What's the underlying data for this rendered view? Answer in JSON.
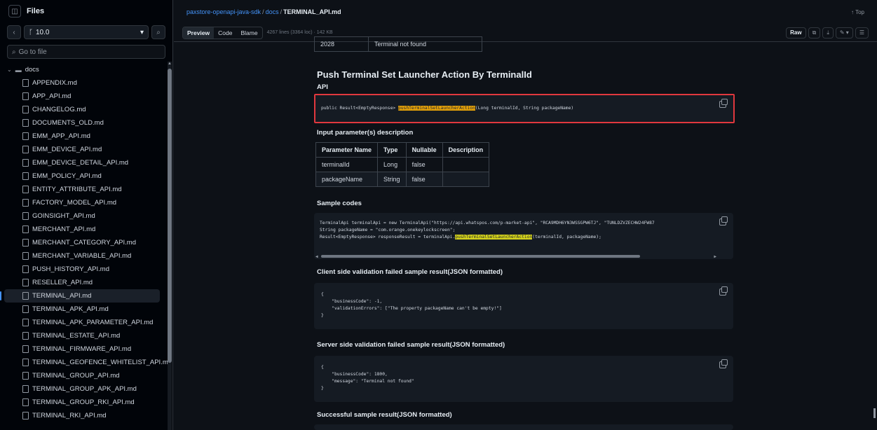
{
  "sidebar": {
    "title": "Files",
    "branch": "10.0",
    "goto_placeholder": "Go to file",
    "folder": "docs",
    "files": [
      "APPENDIX.md",
      "APP_API.md",
      "CHANGELOG.md",
      "DOCUMENTS_OLD.md",
      "EMM_APP_API.md",
      "EMM_DEVICE_API.md",
      "EMM_DEVICE_DETAIL_API.md",
      "EMM_POLICY_API.md",
      "ENTITY_ATTRIBUTE_API.md",
      "FACTORY_MODEL_API.md",
      "GOINSIGHT_API.md",
      "MERCHANT_API.md",
      "MERCHANT_CATEGORY_API.md",
      "MERCHANT_VARIABLE_API.md",
      "PUSH_HISTORY_API.md",
      "RESELLER_API.md",
      "TERMINAL_API.md",
      "TERMINAL_APK_API.md",
      "TERMINAL_APK_PARAMETER_API.md",
      "TERMINAL_ESTATE_API.md",
      "TERMINAL_FIRMWARE_API.md",
      "TERMINAL_GEOFENCE_WHITELIST_API.md",
      "TERMINAL_GROUP_API.md",
      "TERMINAL_GROUP_APK_API.md",
      "TERMINAL_GROUP_RKI_API.md",
      "TERMINAL_RKI_API.md"
    ],
    "active_index": 16
  },
  "breadcrumb": {
    "repo": "paxstore-openapi-java-sdk",
    "dir": "docs",
    "file": "TERMINAL_API.md",
    "top": "↑ Top"
  },
  "toolbar": {
    "tabs": [
      "Preview",
      "Code",
      "Blame"
    ],
    "meta": "4267 lines (3364 loc) · 142 KB",
    "raw": "Raw"
  },
  "doc": {
    "table_top": {
      "code": "2028",
      "message": "Terminal not found"
    },
    "heading": "Push Terminal Set Launcher Action By TerminalId",
    "api_label": "API",
    "api_pre": "public Result<EmptyResponse> ",
    "api_method": "pushTerminalSetLauncherAction",
    "api_post": "(Long terminalId, String packageName)",
    "input_label": "Input parameter(s) description",
    "param_headers": [
      "Parameter Name",
      "Type",
      "Nullable",
      "Description"
    ],
    "params": [
      [
        "terminalId",
        "Long",
        "false",
        ""
      ],
      [
        "packageName",
        "String",
        "false",
        ""
      ]
    ],
    "sample_label": "Sample codes",
    "sample_line1": "TerminalApi terminalApi = new TerminalApi(\"https://api.whatspos.com/p-market-api\", \"RCA9MDH6YN3WSSGPW6TJ\", \"TUNLDZVZECHW24FW87",
    "sample_line2": "String packageName = \"com.orange.onekeylockscreen\";",
    "sample_line3_pre": "Result<EmptyResponse> responseResult = terminalApi.",
    "sample_line3_method": "pushTerminalSetLauncherAction",
    "sample_line3_post": "(terminalId, packageName);",
    "client_label": "Client side validation failed sample result(JSON formatted)",
    "client_json": "{\n    \"businessCode\": -1,\n    \"validationErrors\": [\"The property packageName can't be empty!\"]\n}",
    "server_label": "Server side validation failed sample result(JSON formatted)",
    "server_json": "{\n    \"businessCode\": 1800,\n    \"message\": \"Terminal not found\"\n}",
    "success_label": "Successful sample result(JSON formatted)"
  },
  "colors": {
    "accent": "#4493f8",
    "highlight_box": "#e0383e",
    "method_highlight_orange": "#e3a008",
    "method_highlight_yellow": "#d4d21a"
  }
}
